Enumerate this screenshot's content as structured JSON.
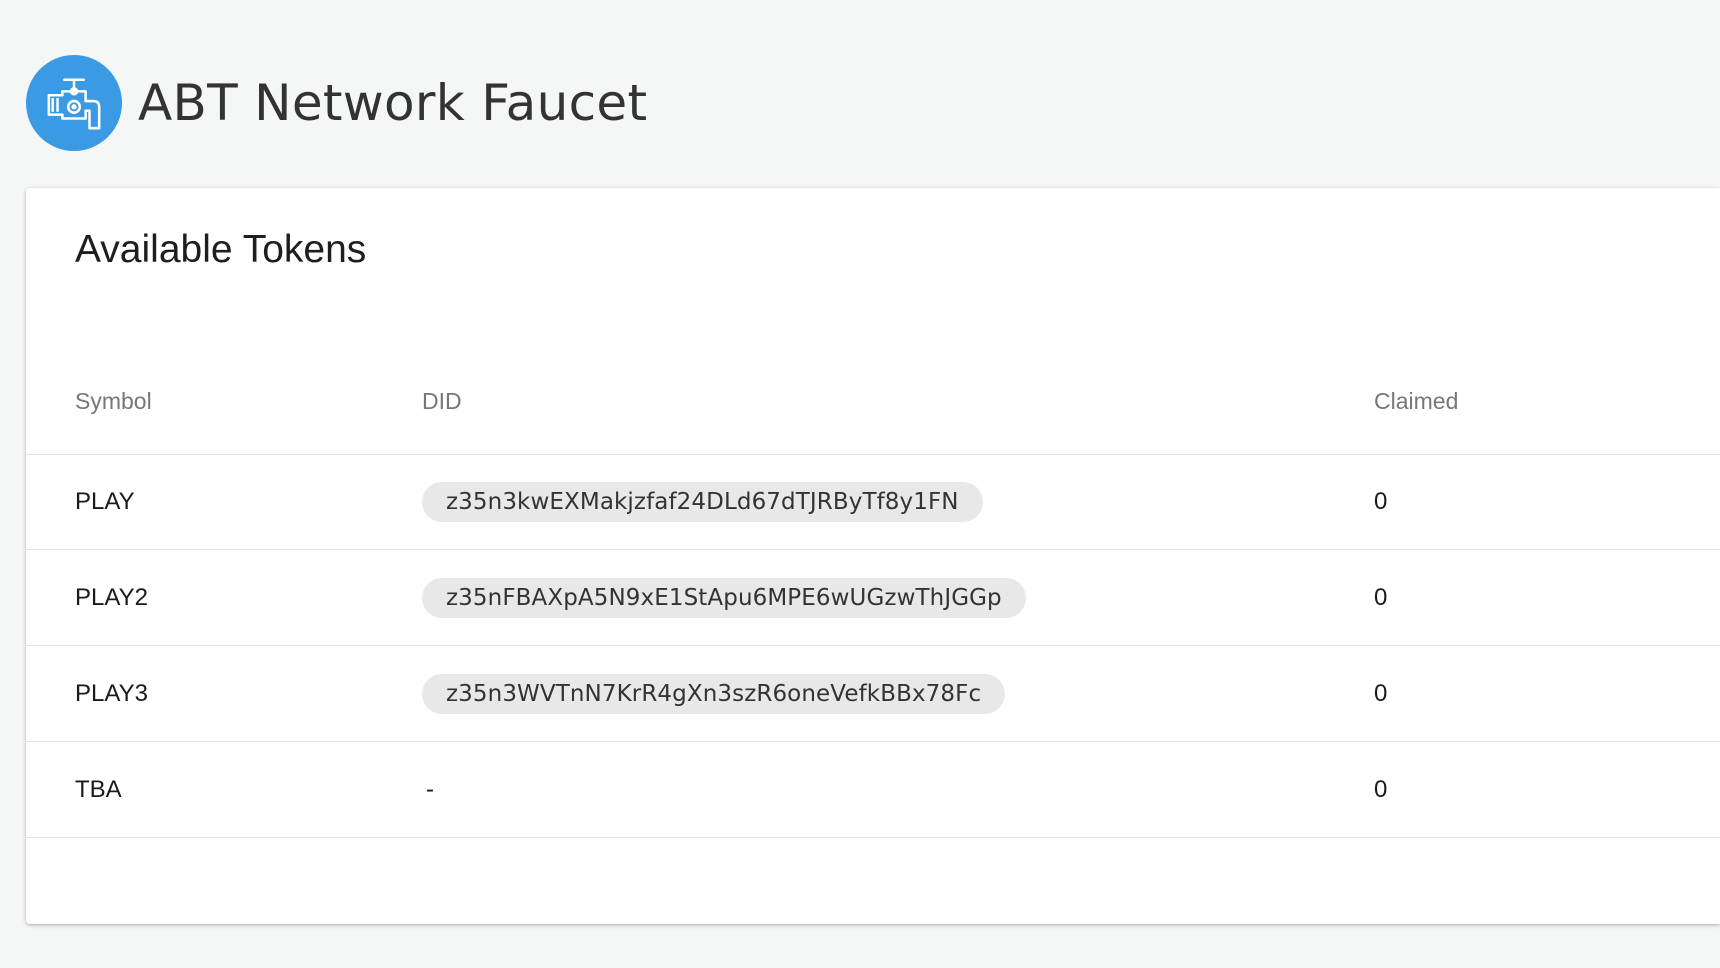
{
  "app": {
    "title": "ABT Network Faucet",
    "logo_icon": "faucet-icon",
    "accent_color": "#3a9be4"
  },
  "tokens_card": {
    "title": "Available Tokens",
    "columns": {
      "symbol": "Symbol",
      "did": "DID",
      "claimed": "Claimed"
    },
    "rows": [
      {
        "symbol": "PLAY",
        "did": "z35n3kwEXMakjzfaf24DLd67dTJRByTf8y1FN",
        "claimed": "0"
      },
      {
        "symbol": "PLAY2",
        "did": "z35nFBAXpA5N9xE1StApu6MPE6wUGzwThJGGp",
        "claimed": "0"
      },
      {
        "symbol": "PLAY3",
        "did": "z35n3WVTnN7KrR4gXn3szR6oneVefkBBx78Fc",
        "claimed": "0"
      },
      {
        "symbol": "TBA",
        "did": "-",
        "claimed": "0"
      }
    ]
  }
}
